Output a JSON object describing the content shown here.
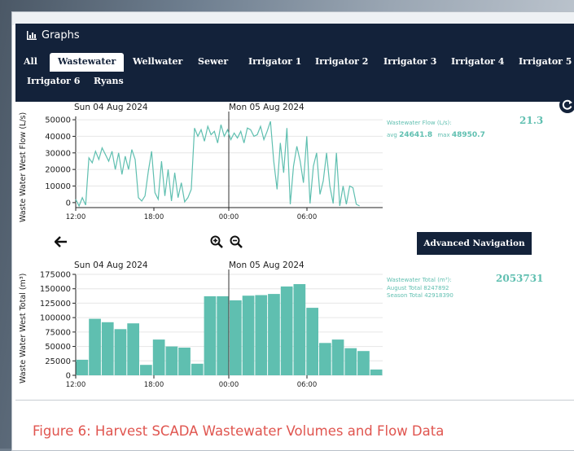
{
  "header": {
    "title": "Graphs",
    "tabs": [
      {
        "label": "All"
      },
      {
        "label": "Wastewater"
      },
      {
        "label": "Wellwater"
      },
      {
        "label": "Sewer"
      },
      {
        "label": "Irrigator 1"
      },
      {
        "label": "Irrigator 2"
      },
      {
        "label": "Irrigator 3"
      },
      {
        "label": "Irrigator 4"
      },
      {
        "label": "Irrigator 5"
      },
      {
        "label": "Irrigator 6"
      },
      {
        "label": "Ryans"
      }
    ],
    "active_tab": "Wastewater"
  },
  "flow_stats": {
    "label": "Wastewater Flow (L/s):",
    "current": "21.3",
    "avg_label": "avg",
    "avg": "24641.8",
    "max_label": "max",
    "max": "48950.7"
  },
  "total_stats": {
    "label": "Wastewater Total (m³):",
    "current": "2053731",
    "august": "August Total 8247892",
    "season": "Season Total 42918390"
  },
  "nav": {
    "back_icon": "arrow-left-icon",
    "zoom_in_icon": "zoom-in-icon",
    "zoom_out_icon": "zoom-out-icon",
    "refresh_icon": "refresh-icon",
    "advanced_label": "Advanced Navigation"
  },
  "caption": "Figure 6: Harvest SCADA Wastewater Volumes and Flow Data",
  "colors": {
    "series": "#5fbfb0",
    "header_bg": "#13223a",
    "caption": "#e0554f"
  },
  "chart_data": [
    {
      "type": "line",
      "title": "",
      "ylabel": "Waste Water West Flow (L/s)",
      "date_labels": [
        "Sun 04 Aug 2024",
        "Mon 05 Aug 2024"
      ],
      "xticks": [
        "12:00",
        "18:00",
        "00:00",
        "06:00"
      ],
      "yticks": [
        0,
        10000,
        20000,
        30000,
        40000,
        50000
      ],
      "ylim": [
        -3000,
        52000
      ],
      "x": [
        0,
        0.25,
        0.5,
        0.75,
        1,
        1.25,
        1.5,
        1.75,
        2,
        2.25,
        2.5,
        2.75,
        3,
        3.25,
        3.5,
        3.75,
        4,
        4.25,
        4.5,
        4.75,
        5,
        5.25,
        5.5,
        5.75,
        6,
        6.25,
        6.5,
        6.75,
        7,
        7.25,
        7.5,
        7.75,
        8,
        8.25,
        8.5,
        8.75,
        9,
        9.25,
        9.5,
        9.75,
        10,
        10.25,
        10.5,
        10.75,
        11,
        11.25,
        11.5,
        11.75,
        12,
        12.25,
        12.5,
        12.75,
        13,
        13.25,
        13.5,
        13.75,
        14,
        14.25,
        14.5,
        14.75,
        15,
        15.25,
        15.5,
        15.75,
        16,
        16.25,
        16.5,
        16.75,
        17,
        17.25,
        17.5,
        17.75,
        18,
        18.25,
        18.5,
        18.75,
        19,
        19.25,
        19.5,
        19.75,
        20,
        20.25,
        20.5,
        20.75,
        21,
        21.25,
        21.5,
        21.75,
        22,
        22.25,
        22.5,
        22.75,
        23,
        23.25
      ],
      "values": [
        2000,
        -2000,
        3000,
        -1500,
        27000,
        24000,
        31000,
        26000,
        33000,
        29000,
        25000,
        31000,
        20000,
        30000,
        17000,
        28000,
        20000,
        32000,
        26000,
        3000,
        1000,
        4000,
        19000,
        31000,
        6000,
        2000,
        25000,
        4000,
        20000,
        1000,
        18000,
        3000,
        12000,
        500,
        3000,
        8000,
        45000,
        40000,
        44000,
        37000,
        46000,
        41000,
        43000,
        36000,
        47000,
        40000,
        44000,
        38000,
        42000,
        39000,
        43000,
        36000,
        45000,
        44000,
        40000,
        41000,
        46000,
        38000,
        43000,
        49000,
        25000,
        8000,
        36000,
        18000,
        45000,
        -1000,
        22000,
        34000,
        25000,
        12000,
        40000,
        -500,
        22000,
        30000,
        5000,
        13000,
        30000,
        10000,
        -500,
        30000,
        -2000,
        10000,
        -1000,
        10000,
        9000,
        -1000,
        -2000,
        0,
        0,
        0,
        0,
        0,
        0,
        0
      ],
      "n_points": 87
    },
    {
      "type": "bar",
      "title": "",
      "ylabel": "Waste Water West Total (m³)",
      "date_labels": [
        "Sun 04 Aug 2024",
        "Mon 05 Aug 2024"
      ],
      "xticks": [
        "12:00",
        "18:00",
        "00:00",
        "06:00"
      ],
      "yticks": [
        0,
        25000,
        50000,
        75000,
        100000,
        125000,
        150000,
        175000
      ],
      "ylim": [
        0,
        175000
      ],
      "values": [
        27000,
        98000,
        92000,
        80000,
        90000,
        18000,
        62000,
        50000,
        48000,
        20000,
        137000,
        137000,
        130000,
        138000,
        139000,
        141000,
        154000,
        158000,
        117000,
        56000,
        62000,
        47000,
        42000,
        10000
      ]
    }
  ]
}
